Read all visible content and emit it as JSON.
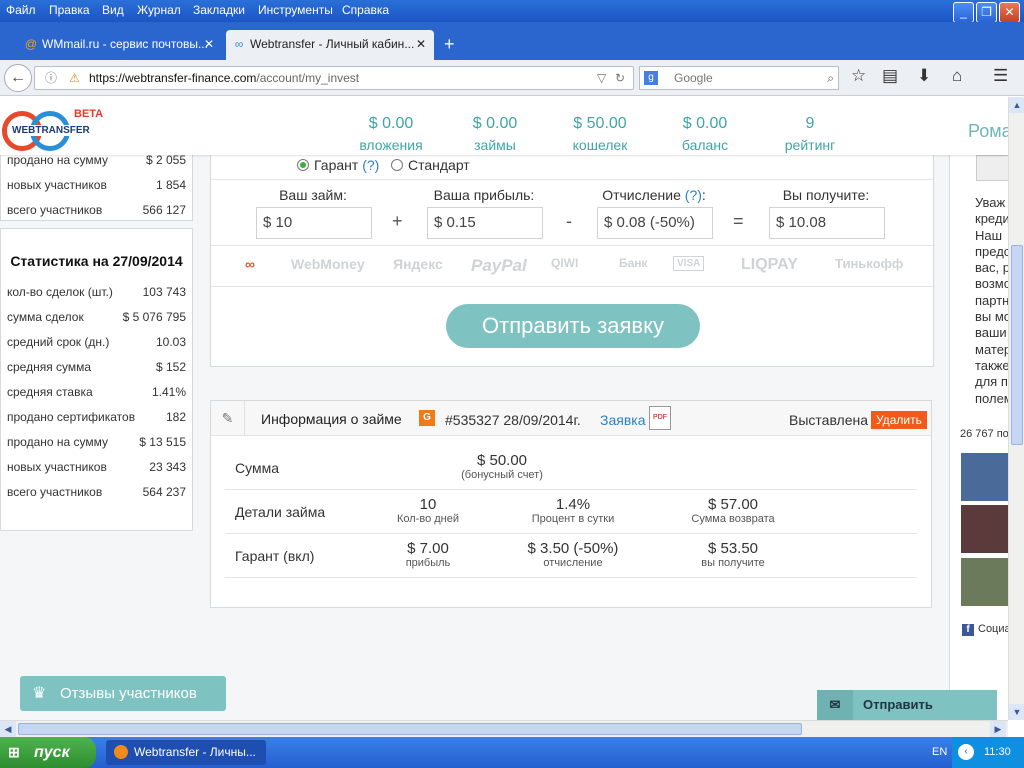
{
  "menubar": {
    "items": [
      "Файл",
      "Правка",
      "Вид",
      "Журнал",
      "Закладки",
      "Инструменты",
      "Справка"
    ]
  },
  "tabs": [
    {
      "title": "WMmail.ru - сервис почтовы...",
      "icon": "at-sign-icon"
    },
    {
      "title": "Webtransfer - Личный кабин...",
      "icon": "webtransfer-logo-icon"
    }
  ],
  "urlbar": {
    "host": "https://webtransfer-finance.com",
    "path": "/account/my_invest"
  },
  "search": {
    "placeholder": "Google"
  },
  "logo": {
    "text": "WEBTRANSFER",
    "beta": "BETA"
  },
  "header_stats": [
    {
      "value": "$ 0.00",
      "label": "вложения"
    },
    {
      "value": "$ 0.00",
      "label": "займы"
    },
    {
      "value": "$ 50.00",
      "label": "кошелек"
    },
    {
      "value": "$ 0.00",
      "label": "баланс"
    },
    {
      "value": "9",
      "label": "рейтинг"
    }
  ],
  "user": {
    "name": "Рома"
  },
  "sidebar_top": [
    {
      "label": "продано на сумму",
      "value": "$ 2 055"
    },
    {
      "label": "новых участников",
      "value": "1 854"
    },
    {
      "label": "всего участников",
      "value": "566 127"
    }
  ],
  "sidebar_stats": {
    "title": "Статистика на 27/09/2014",
    "rows": [
      {
        "label": "кол-во сделок (шт.)",
        "value": "103 743"
      },
      {
        "label": "сумма сделок",
        "value": "$ 5 076 795"
      },
      {
        "label": "средний срок (дн.)",
        "value": "10.03"
      },
      {
        "label": "средняя сумма",
        "value": "$ 152"
      },
      {
        "label": "средняя ставка",
        "value": "1.41%"
      },
      {
        "label": "продано сертификатов",
        "value": "182"
      },
      {
        "label": "продано на сумму",
        "value": "$ 13 515"
      },
      {
        "label": "новых участников",
        "value": "23 343"
      },
      {
        "label": "всего участников",
        "value": "564 237"
      }
    ]
  },
  "form": {
    "radio_garant": "Гарант",
    "radio_standard": "Стандарт",
    "help": "(?)",
    "loan_label": "Ваш займ:",
    "loan_value": "$ 10",
    "profit_label": "Ваша прибыль:",
    "profit_value": "$ 0.15",
    "fee_label": "Отчисление",
    "fee_help": "(?)",
    "fee_colon": ":",
    "fee_value": "$ 0.08 (-50%)",
    "receive_label": "Вы получите:",
    "receive_value": "$ 10.08",
    "op_plus": "+",
    "op_minus": "-",
    "op_equals": "=",
    "payment_systems": [
      "WebMoney",
      "Яндекс",
      "PayPal",
      "QIWI",
      "Банк",
      "VISA",
      "LIQPAY",
      "Тинькофф"
    ],
    "submit": "Отправить заявку"
  },
  "info": {
    "title": "Информация о займе",
    "badge": "G",
    "loan_id": "#535327 28/09/2014г.",
    "application_link": "Заявка",
    "pdf_label": "PDF",
    "status": "Выставлена",
    "delete": "Удалить",
    "rows": [
      {
        "label": "Сумма",
        "cells": [
          {
            "value": "$ 50.00",
            "sub": "(бонусный счет)"
          }
        ]
      },
      {
        "label": "Детали займа",
        "cells": [
          {
            "value": "10",
            "sub": "Кол-во дней"
          },
          {
            "value": "1.4%",
            "sub": "Процент в сутки"
          },
          {
            "value": "$ 57.00",
            "sub": "Сумма возврата"
          }
        ]
      },
      {
        "label": "Гарант (вкл)",
        "cells": [
          {
            "value": "$ 7.00",
            "sub": "прибыль"
          },
          {
            "value": "$ 3.50 (-50%)",
            "sub": "отчисление"
          },
          {
            "value": "$ 53.50",
            "sub": "вы получите"
          }
        ]
      }
    ]
  },
  "right_panel": {
    "text_lines": [
      "Уваж",
      "креди",
      "Наш",
      "предс",
      "вас, р",
      "возмо",
      "партн",
      "вы мо",
      "ваши",
      "матер",
      "также",
      "для п",
      "полем"
    ],
    "count": "26 767 по",
    "social": "Социа"
  },
  "buttons": {
    "reviews": "Отзывы участников",
    "send": "Отправить"
  },
  "taskbar": {
    "start": "пуск",
    "task": "Webtransfer - Личны...",
    "lang": "EN",
    "clock": "11:30"
  }
}
